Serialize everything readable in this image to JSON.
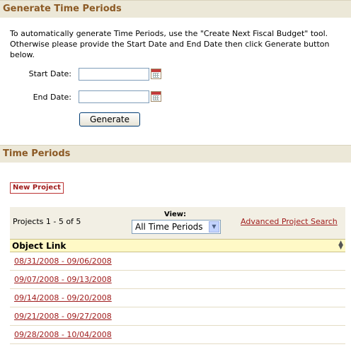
{
  "generate_section": {
    "title": "Generate Time Periods",
    "description": "To automatically generate Time Periods, use the \"Create Next Fiscal Budget\" tool. Otherwise please provide the Start Date and End Date then click Generate button below.",
    "start_label": "Start Date:",
    "start_value": "",
    "end_label": "End Date:",
    "end_value": "",
    "generate_button": "Generate"
  },
  "periods_section": {
    "title": "Time Periods",
    "new_project_button": "New Project",
    "count_text": "Projects 1 - 5 of 5",
    "view_label": "View:",
    "view_selected": "All Time Periods",
    "advanced_search_link": "Advanced Project Search",
    "column_header": "Object Link",
    "rows": [
      "08/31/2008 - 09/06/2008",
      "09/07/2008 - 09/13/2008",
      "09/14/2008 - 09/20/2008",
      "09/21/2008 - 09/27/2008",
      "09/28/2008 - 10/04/2008"
    ]
  },
  "icons": [
    "calendar-icon",
    "chevron-down-icon",
    "sort-icon"
  ],
  "colors": {
    "section_title": "#8c5a25",
    "link": "#a01c1c",
    "header_bg": "#ece8d8",
    "table_header_bg": "#fff9c6"
  }
}
